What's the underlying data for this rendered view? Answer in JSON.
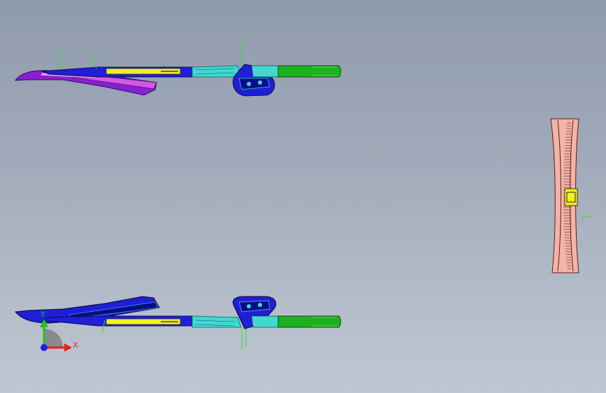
{
  "viewport": {
    "background_top": "#8f9aab",
    "background_bottom": "#bfc6d1"
  },
  "triad": {
    "x_label": "X",
    "y_label": "Y",
    "x_color": "#e8201c",
    "y_color": "#22c01d",
    "z_color": "#1c24e0"
  },
  "part_colors": {
    "blue": "#1f1fd6",
    "dark_blue": "#0b0b8a",
    "purple": "#8a1fd6",
    "magenta": "#c23fd8",
    "cyan": "#41d8d0",
    "yellow": "#f2f020",
    "green": "#1db21d",
    "pink": "#f0b4a8",
    "dark_red": "#6a1a10"
  }
}
